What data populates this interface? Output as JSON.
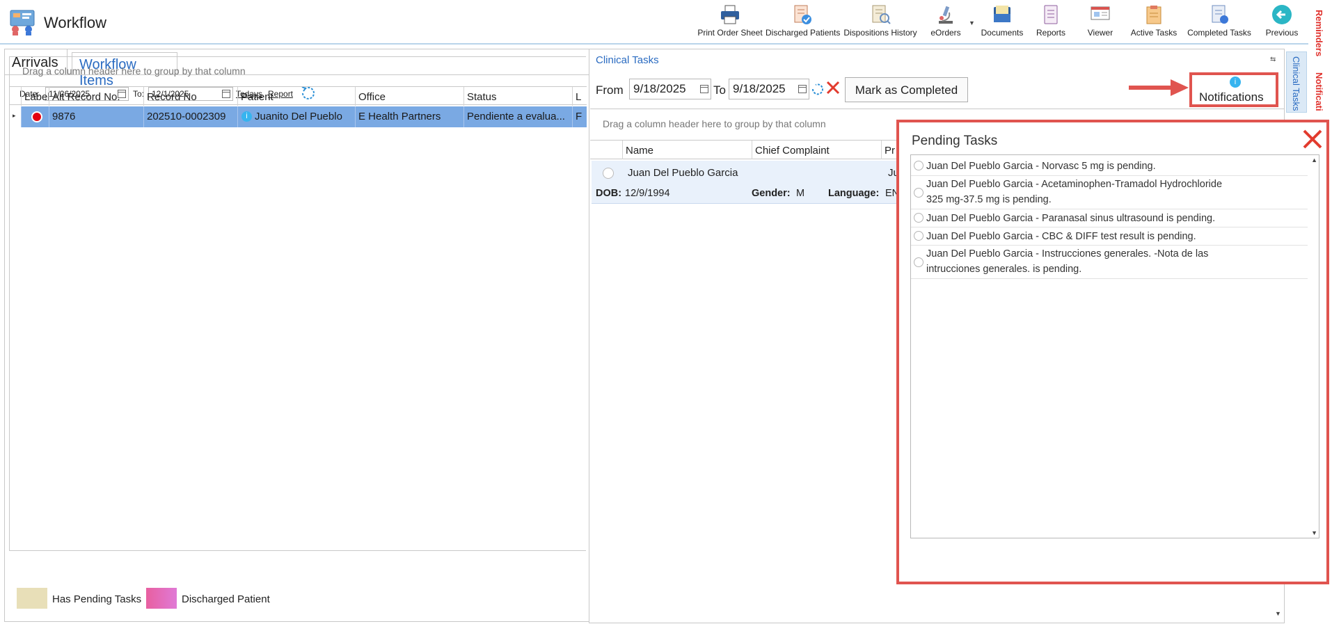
{
  "app": {
    "title": "Workflow"
  },
  "toolbar": {
    "items": [
      {
        "label": "Print Order Sheet",
        "icon": "printer-icon"
      },
      {
        "label": "Discharged Patients",
        "icon": "discharged-patients-icon"
      },
      {
        "label": "Dispositions History",
        "icon": "dispositions-history-icon"
      },
      {
        "label": "eOrders",
        "icon": "microscope-icon"
      },
      {
        "label": "Documents",
        "icon": "documents-icon"
      },
      {
        "label": "Reports",
        "icon": "reports-icon"
      },
      {
        "label": "Viewer",
        "icon": "viewer-icon"
      },
      {
        "label": "Active Tasks",
        "icon": "active-tasks-icon"
      },
      {
        "label": "Completed Tasks",
        "icon": "completed-tasks-icon"
      },
      {
        "label": "Previous",
        "icon": "back-arrow-icon"
      }
    ]
  },
  "side_tabs": {
    "reminders": "Reminders",
    "notifications": "Notificati"
  },
  "left": {
    "tabs": [
      "Arrivals",
      "Workflow Items"
    ],
    "date_label": "Date:",
    "date_from": "11/26/2025",
    "to_label": "To:",
    "date_to": "12/1/2025",
    "todays": "Todays",
    "report": "Report",
    "group_hint": "Drag a column header here to group by that column",
    "columns": [
      "Label",
      "Alt Record No.",
      "Record No",
      "Patient",
      "Office",
      "Status",
      "L"
    ],
    "row": {
      "alt_record": "9876",
      "record_no": "202510-0002309",
      "patient": "Juanito Del Pueblo",
      "office": "E Health Partners",
      "status": "Pendiente a evalua...",
      "extra": "F"
    },
    "legend": [
      {
        "label": "Has Pending Tasks",
        "color": "#e8dfb8"
      },
      {
        "label": "Discharged Patient",
        "color": "#e46bb2"
      }
    ]
  },
  "right": {
    "title": "Clinical Tasks",
    "from_label": "From",
    "date_from": "9/18/2025",
    "to_label": "To",
    "date_to": "9/18/2025",
    "mark_completed": "Mark as Completed",
    "notifications": "Notifications",
    "group_hint": "Drag a column header here to group by that column",
    "columns": [
      "Name",
      "Chief Complaint",
      "Pr"
    ],
    "patient_row": {
      "name": "Juan Del Pueblo Garcia",
      "extra": "Ju",
      "dob_label": "DOB:",
      "dob": "12/9/1994",
      "gender_label": "Gender:",
      "gender": "M",
      "language_label": "Language:",
      "language": "EN"
    },
    "vertical_tab": "Clinical Tasks"
  },
  "pending": {
    "title": "Pending Tasks",
    "tasks": [
      [
        "Juan Del Pueblo Garcia - Norvasc 5 mg is pending."
      ],
      [
        "Juan Del Pueblo Garcia - Acetaminophen-Tramadol Hydrochloride",
        "325 mg-37.5 mg is pending."
      ],
      [
        "Juan Del Pueblo Garcia - Paranasal sinus ultrasound is pending."
      ],
      [
        "Juan Del Pueblo Garcia - CBC & DIFF test result is pending."
      ],
      [
        "Juan Del Pueblo Garcia - Instrucciones generales. -Nota de las",
        "intrucciones generales. is pending."
      ]
    ]
  },
  "colors": {
    "accent": "#2a6bc1",
    "selected_row": "#7aa9e3",
    "highlight": "#e0544f"
  }
}
